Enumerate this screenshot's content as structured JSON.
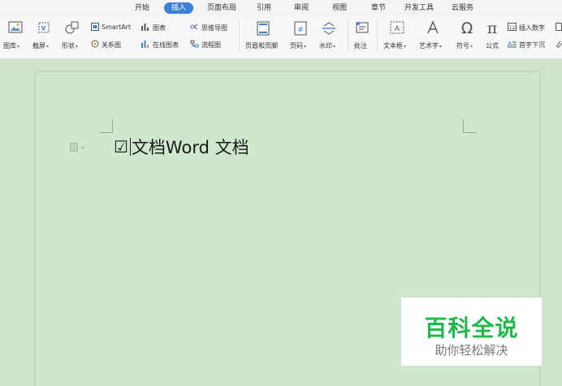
{
  "tabs": [
    "开始",
    "插入",
    "页面布局",
    "引用",
    "审阅",
    "视图",
    "章节",
    "开发工具",
    "云服务"
  ],
  "active_tab": "插入",
  "ribbon": {
    "gallery": "图库",
    "screenshot": "截屏",
    "shape": "形状",
    "smartart": "SmartArt",
    "relation": "关系图",
    "chart": "图表",
    "online_chart": "在线图表",
    "mindmap": "思维导图",
    "flowchart": "流程图",
    "header_footer": "页眉和页脚",
    "page_number": "页码",
    "watermark": "水印",
    "comment": "批注",
    "textbox": "文本框",
    "wordart": "艺术字",
    "symbol": "符号",
    "formula": "公式",
    "insert_number": "插入数字",
    "drop_cap": "首字下沉"
  },
  "document": {
    "checkbox": "☑",
    "text": "文档Word 文档"
  },
  "watermark": {
    "title": "百科全说",
    "subtitle": "助你轻松解决"
  },
  "colors": {
    "active_tab": "#3b7fd8",
    "page_bg": "#cfe7cd",
    "watermark_green": "#1fb84a"
  }
}
